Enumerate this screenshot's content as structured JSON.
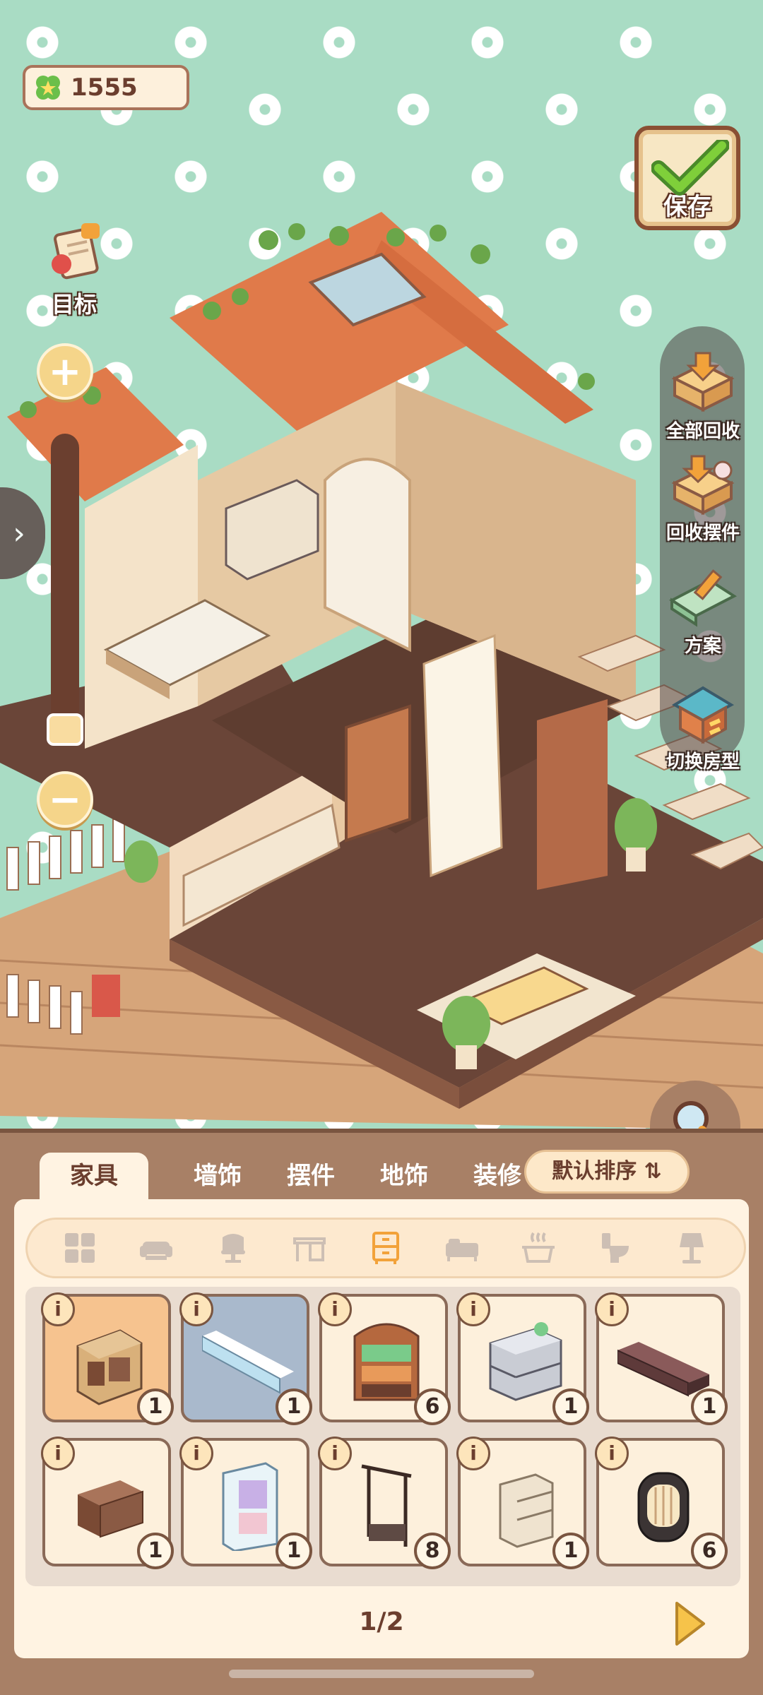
{
  "currency": {
    "value": "1555",
    "icon": "clover-icon"
  },
  "save": {
    "label": "保存",
    "icon": "checkmark-icon"
  },
  "target": {
    "label": "目标",
    "icon": "scroll-icon"
  },
  "zoom": {
    "plus": "+",
    "minus": "−",
    "expand": "›"
  },
  "tools": [
    {
      "label": "全部回收",
      "icon": "recycle-all-icon"
    },
    {
      "label": "回收摆件",
      "icon": "recycle-decor-icon"
    },
    {
      "label": "方案",
      "icon": "blueprint-icon"
    },
    {
      "label": "切换房型",
      "icon": "switch-house-icon"
    }
  ],
  "tabs": [
    {
      "label": "家具",
      "active": true
    },
    {
      "label": "墙饰",
      "active": false
    },
    {
      "label": "摆件",
      "active": false
    },
    {
      "label": "地饰",
      "active": false
    },
    {
      "label": "装修",
      "active": false
    }
  ],
  "sort": {
    "label": "默认排序",
    "icon": "sort-icon"
  },
  "categories": [
    {
      "icon": "grid-all-icon",
      "active": false
    },
    {
      "icon": "sofa-icon",
      "active": false
    },
    {
      "icon": "chair-icon",
      "active": false
    },
    {
      "icon": "desk-icon",
      "active": false
    },
    {
      "icon": "cabinet-icon",
      "active": true
    },
    {
      "icon": "bed-icon",
      "active": false
    },
    {
      "icon": "stove-icon",
      "active": false
    },
    {
      "icon": "toilet-icon",
      "active": false
    },
    {
      "icon": "lamp-icon",
      "active": false
    }
  ],
  "items": [
    {
      "name": "cube-shelf",
      "count": "1",
      "info": "i"
    },
    {
      "name": "wall-shelf",
      "count": "1",
      "info": "i"
    },
    {
      "name": "bookcase",
      "count": "6",
      "info": "i"
    },
    {
      "name": "drawer-cabinet",
      "count": "1",
      "info": "i"
    },
    {
      "name": "tv-stand",
      "count": "1",
      "info": "i"
    },
    {
      "name": "nightstand",
      "count": "1",
      "info": "i"
    },
    {
      "name": "display-closet",
      "count": "1",
      "info": "i"
    },
    {
      "name": "coat-rack",
      "count": "8",
      "info": "i"
    },
    {
      "name": "small-dresser",
      "count": "1",
      "info": "i"
    },
    {
      "name": "heater",
      "count": "6",
      "info": "i"
    }
  ],
  "pager": {
    "text": "1/2"
  },
  "colors": {
    "accent": "#6b3e2e",
    "background": "#a9dcc4",
    "panel": "#a88066"
  }
}
